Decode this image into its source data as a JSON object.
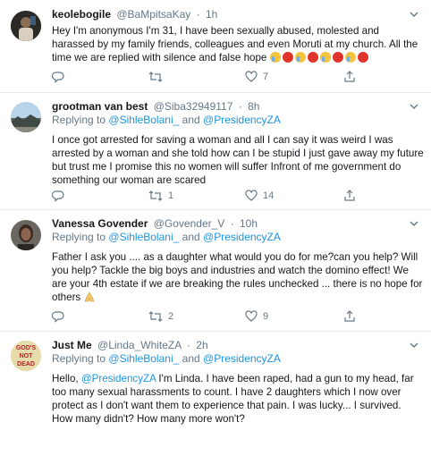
{
  "tweets": [
    {
      "name": "keolebogile",
      "handle": "@BaMpitsaKay",
      "time": "1h",
      "replying_prefix": "",
      "replying_to": [],
      "text": "Hey I'm anonymous I'm 31, I have been sexually abused,  molested and harassed by my family friends, colleagues and even Moruti at my church. All the time we are replied with silence and false hope",
      "emojis": [
        "crying-face",
        "angry-face",
        "crying-face",
        "angry-face",
        "crying-face",
        "angry-face",
        "crying-face",
        "angry-face"
      ],
      "retweets": "",
      "likes": "7"
    },
    {
      "name": "grootman van best",
      "handle": "@Siba32949117",
      "time": "8h",
      "replying_prefix": "Replying to",
      "replying_to": [
        "@SihleBolani_",
        "and",
        "@PresidencyZA"
      ],
      "text": "I once got arrested for saving a woman and all I can say it was weird I was arrested by a woman and she told how can I be stupid I just gave away my future but trust me I promise this no women will suffer Infront of me government do something our woman are scared",
      "retweets": "1",
      "likes": "14"
    },
    {
      "name": "Vanessa Govender",
      "handle": "@Govender_V",
      "time": "10h",
      "replying_prefix": "Replying to",
      "replying_to": [
        "@SihleBolani_",
        "and",
        "@PresidencyZA"
      ],
      "text": "Father I ask you .... as a daughter what would you do for me?can you help? Will you help? Tackle the big boys and industries and watch the domino effect! We are your 4th estate if we are breaking the rules unchecked ... there is no hope for others",
      "emojis": [
        "folded-hands"
      ],
      "retweets": "2",
      "likes": "9"
    },
    {
      "name": "Just Me",
      "handle": "@Linda_WhiteZA",
      "time": "2h",
      "replying_prefix": "Replying to",
      "replying_to": [
        "@SihleBolani_",
        "and",
        "@PresidencyZA"
      ],
      "text_prefix": "Hello, ",
      "text_mention": "@PresidencyZA",
      "text": " I'm Linda. I have been raped, had a gun to my head, far too many sexual harassments to count. I have 2 daughters which I now over protect as I don't want them to experience that pain. I was lucky... I survived. How many didn't? How many more won't?",
      "avatar_text": [
        "GOD'S",
        "NOT",
        "DEAD"
      ]
    }
  ],
  "colors": {
    "link": "#1b95e0",
    "muted": "#657786",
    "divider": "#e6ecf0",
    "text": "#14171a"
  }
}
